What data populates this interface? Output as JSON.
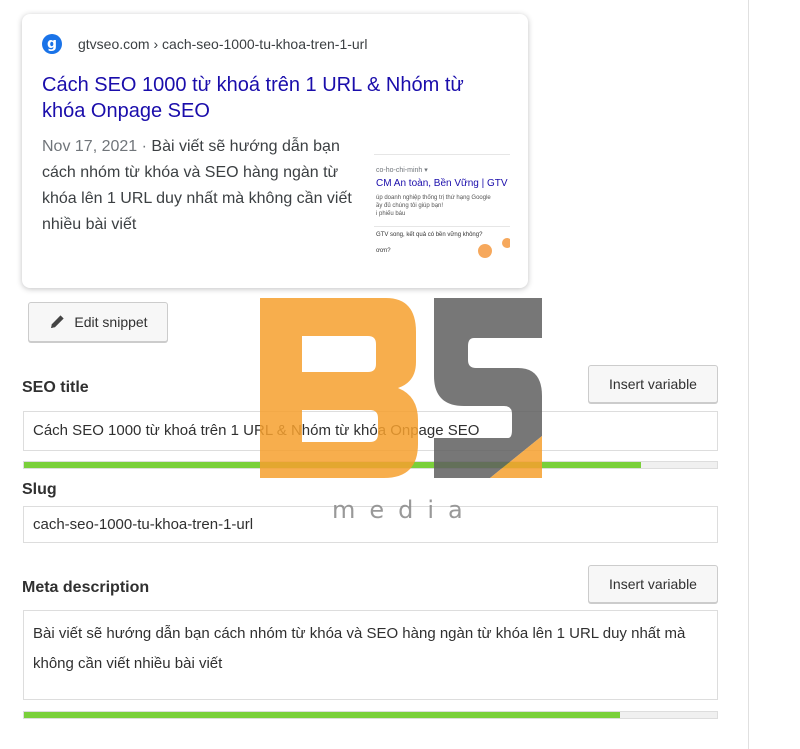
{
  "preview": {
    "favicon_letter": "g",
    "breadcrumb": "gtvseo.com › cach-seo-1000-tu-khoa-tren-1-url",
    "title": "Cách SEO 1000 từ khoá trên 1 URL & Nhóm từ khóa Onpage SEO",
    "date": "Nov 17, 2021 · ",
    "description": "Bài viết sẽ hướng dẫn bạn cách nhóm từ khóa và SEO hàng ngàn từ khóa lên 1 URL duy nhất mà không cần viết nhiều bài viết",
    "thumbnail": {
      "crumb": "co-ho-chi-minh ▾",
      "headline": "CM An toàn, Bền Vững | GTV S",
      "line1": "úp doanh nghiệp thống trị thứ hạng Google",
      "line2": "ầy đủ chúng tôi giúp bạn!",
      "line3": "i phiếu báu",
      "question": "GTV song, kết quả có bền vững không?",
      "footer": "ơơn?"
    }
  },
  "edit_snippet_label": "Edit snippet",
  "seo_title": {
    "label": "SEO title",
    "insert_variable_label": "Insert variable",
    "value": "Cách SEO 1000 từ khoá trên 1 URL & Nhóm từ khóa Onpage SEO",
    "progress": 0.89
  },
  "slug": {
    "label": "Slug",
    "value": "cach-seo-1000-tu-khoa-tren-1-url"
  },
  "meta_description": {
    "label": "Meta description",
    "insert_variable_label": "Insert variable",
    "value": "Bài viết sẽ hướng dẫn bạn cách nhóm từ khóa và SEO hàng ngàn từ khóa lên 1 URL duy nhất mà không cần viết nhiều bài viết",
    "progress": 0.86
  },
  "watermark": {
    "logo": "BS",
    "text": "media"
  },
  "colors": {
    "link_blue": "#1a0dab",
    "progress_green": "#7ad03a",
    "watermark_orange": "#f6a02e",
    "watermark_gray": "#6b6b6b"
  }
}
